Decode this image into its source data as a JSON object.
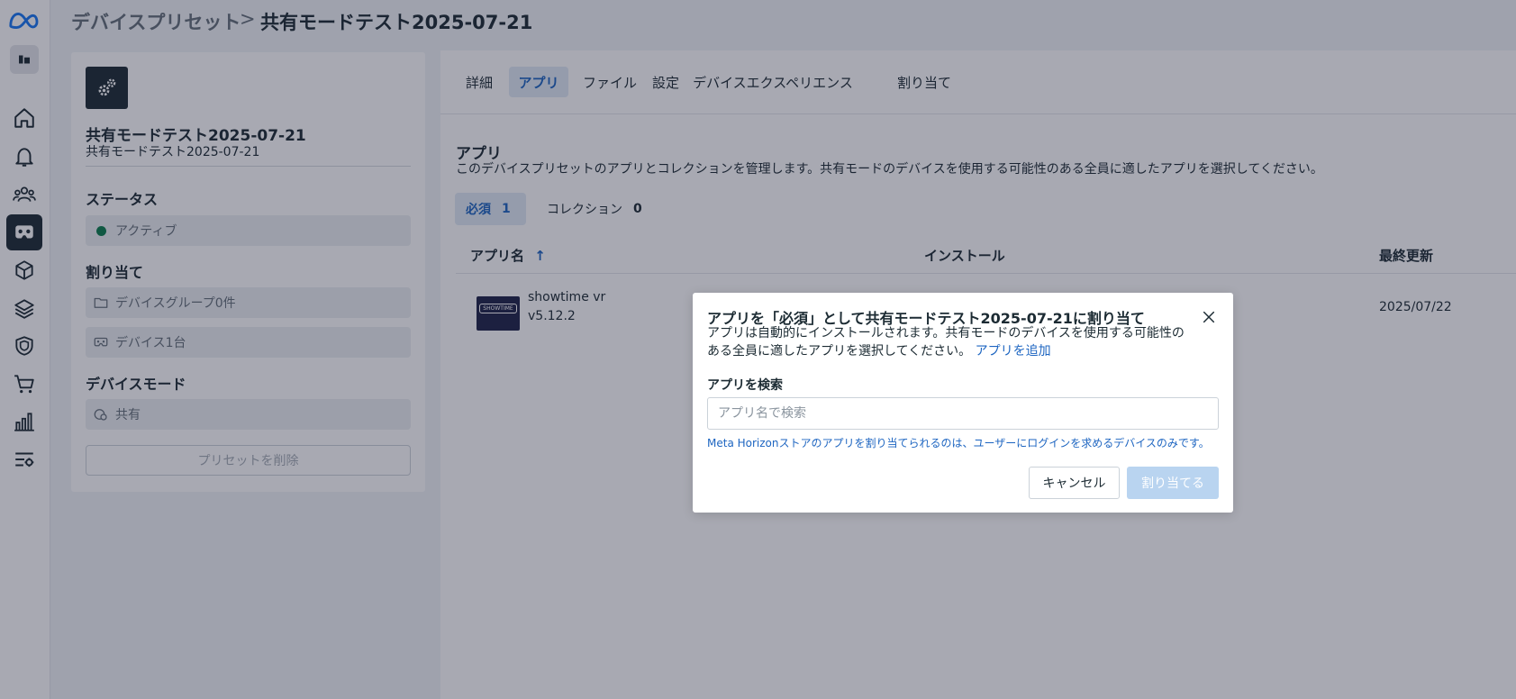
{
  "breadcrumb": {
    "root": "デバイスプリセット",
    "separator": ">",
    "current": "共有モードテスト2025-07-21"
  },
  "rail": {
    "items": [
      "meta-logo",
      "org-switcher",
      "home",
      "notifications",
      "users",
      "devices",
      "apps",
      "layers",
      "security",
      "store",
      "analytics",
      "settings"
    ],
    "active": "devices"
  },
  "preset": {
    "title": "共有モードテスト2025-07-21",
    "subtitle": "共有モードテスト2025-07-21",
    "status_heading": "ステータス",
    "status_value": "アクティブ",
    "status_color": "#0a7d4c",
    "assign_heading": "割り当て",
    "device_groups": "デバイスグループ0件",
    "devices": "デバイス1台",
    "mode_heading": "デバイスモード",
    "mode_value": "共有",
    "delete_label": "プリセットを削除"
  },
  "tabs": [
    {
      "label": "詳細",
      "active": false
    },
    {
      "label": "アプリ",
      "active": true
    },
    {
      "label": "ファイル",
      "active": false
    },
    {
      "label": "設定",
      "active": false
    },
    {
      "label": "デバイスエクスペリエンス",
      "active": false
    },
    {
      "label": "割り当て",
      "active": false
    }
  ],
  "apps": {
    "heading": "アプリ",
    "description": "このデバイスプリセットのアプリとコレクションを管理します。共有モードのデバイスを使用する可能性のある全員に適したアプリを選択してください。",
    "subtabs": [
      {
        "label": "必須",
        "count": "1",
        "active": true
      },
      {
        "label": "コレクション",
        "count": "0",
        "active": false
      }
    ],
    "columns": {
      "name": "アプリ名",
      "sort_icon": "↑",
      "install": "インストール",
      "updated": "最終更新"
    },
    "rows": [
      {
        "name": "showtime vr",
        "version": "v5.12.2",
        "updated": "2025/07/22",
        "thumb_text": "SHOWTIME"
      }
    ]
  },
  "modal": {
    "title": "アプリを「必須」として共有モードテスト2025-07-21に割り当て",
    "description": "アプリは自動的にインストールされます。共有モードのデバイスを使用する可能性のある全員に適したアプリを選択してください。",
    "add_link": "アプリを追加",
    "search_label": "アプリを検索",
    "search_placeholder": "アプリ名で検索",
    "search_value": "",
    "note": "Meta Horizonストアのアプリを割り当てられるのは、ユーザーにログインを求めるデバイスのみです。",
    "cancel_label": "キャンセル",
    "assign_label": "割り当てる"
  },
  "colors": {
    "accent": "#1d65c1",
    "text": "#1c2b33",
    "assign_disabled": "#b9d4f0"
  }
}
